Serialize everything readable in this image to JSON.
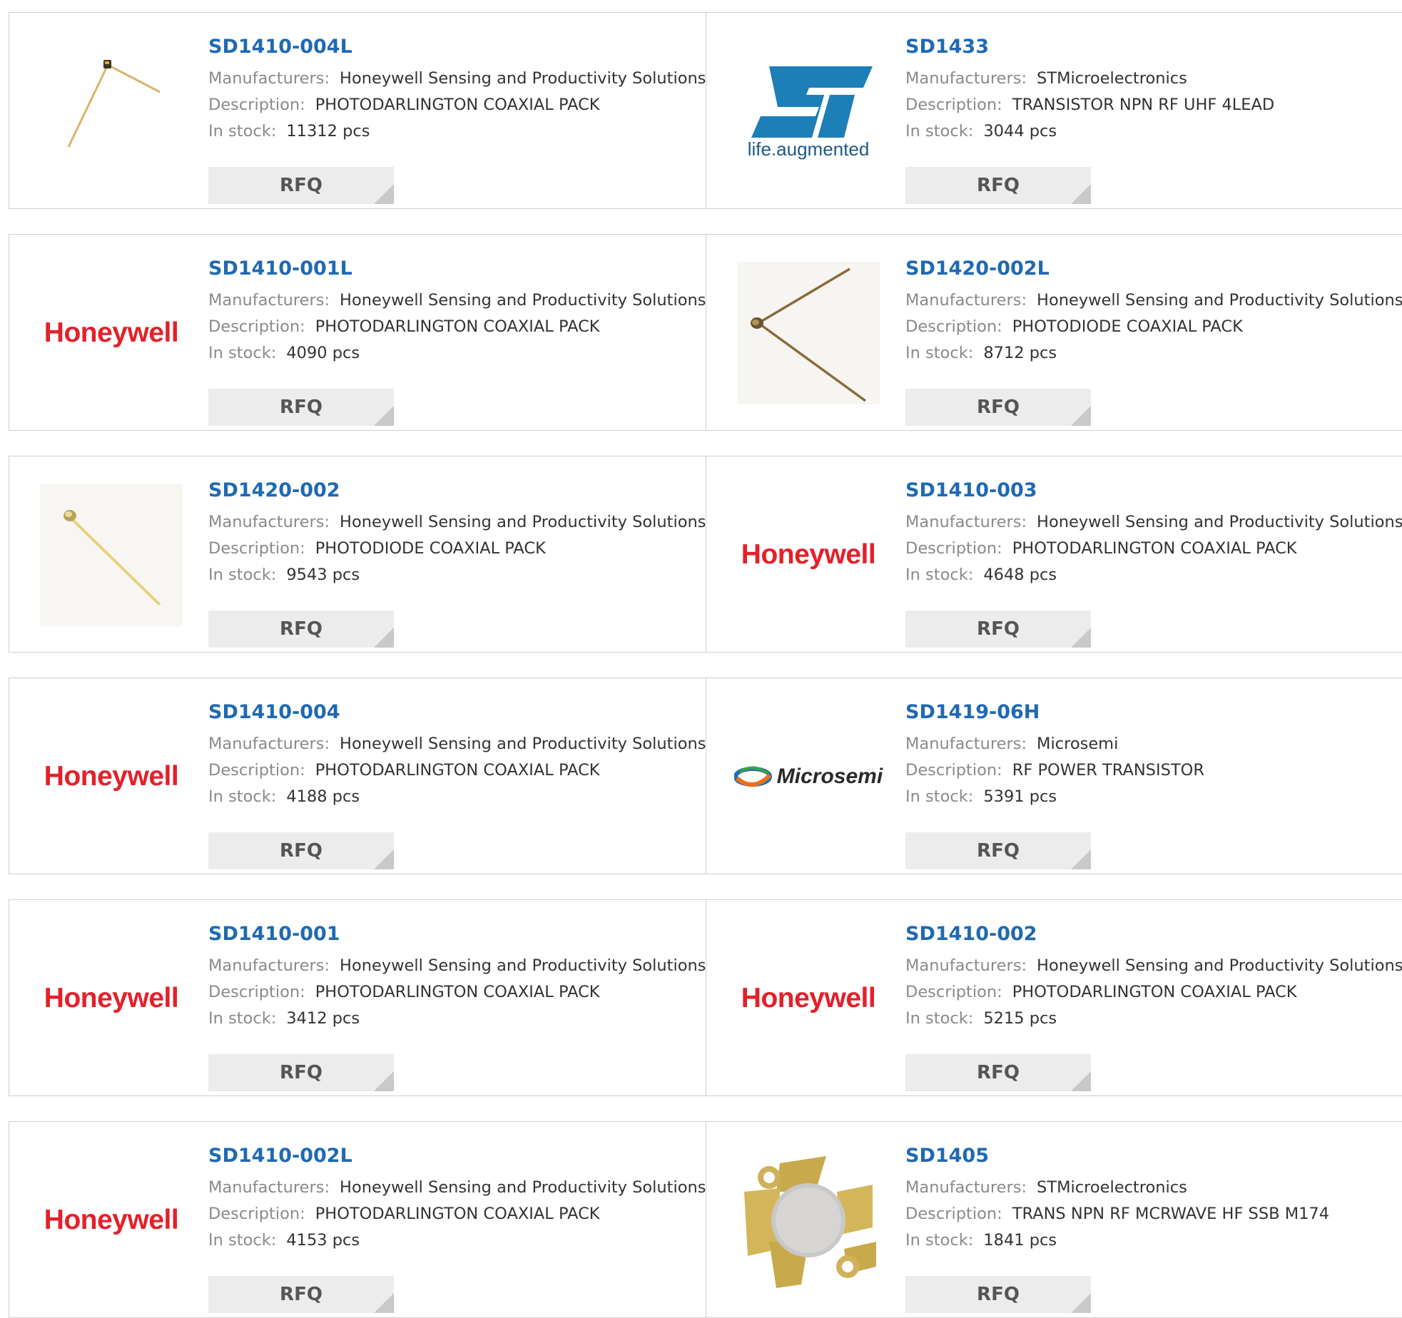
{
  "labels": {
    "manufacturers": "Manufacturers:",
    "description": "Description:",
    "in_stock": "In stock:",
    "rfq": "RFQ"
  },
  "products": [
    {
      "part": "SD1410-004L",
      "manufacturer": "Honeywell Sensing and Productivity Solutions",
      "description": "PHOTODARLINGTON COAXIAL PACK",
      "stock": "11312 pcs",
      "image": "component-wire-photo"
    },
    {
      "part": "SD1433",
      "manufacturer": "STMicroelectronics",
      "description": "TRANSISTOR NPN RF UHF 4LEAD",
      "stock": "3044 pcs",
      "image": "st-logo",
      "logo_tagline": "life.augmented"
    },
    {
      "part": "SD1410-001L",
      "manufacturer": "Honeywell Sensing and Productivity Solutions",
      "description": "PHOTODARLINGTON COAXIAL PACK",
      "stock": "4090 pcs",
      "image": "honeywell-logo",
      "logo_text": "Honeywell"
    },
    {
      "part": "SD1420-002L",
      "manufacturer": "Honeywell Sensing and Productivity Solutions",
      "description": "PHOTODIODE COAXIAL PACK",
      "stock": "8712 pcs",
      "image": "component-bent-wire-photo"
    },
    {
      "part": "SD1420-002",
      "manufacturer": "Honeywell Sensing and Productivity Solutions",
      "description": "PHOTODIODE COAXIAL PACK",
      "stock": "9543 pcs",
      "image": "component-straight-wire-photo"
    },
    {
      "part": "SD1410-003",
      "manufacturer": "Honeywell Sensing and Productivity Solutions",
      "description": "PHOTODARLINGTON COAXIAL PACK",
      "stock": "4648 pcs",
      "image": "honeywell-logo",
      "logo_text": "Honeywell"
    },
    {
      "part": "SD1410-004",
      "manufacturer": "Honeywell Sensing and Productivity Solutions",
      "description": "PHOTODARLINGTON COAXIAL PACK",
      "stock": "4188 pcs",
      "image": "honeywell-logo",
      "logo_text": "Honeywell"
    },
    {
      "part": "SD1419-06H",
      "manufacturer": "Microsemi",
      "description": "RF POWER TRANSISTOR",
      "stock": "5391 pcs",
      "image": "microsemi-logo",
      "logo_text": "Microsemi"
    },
    {
      "part": "SD1410-001",
      "manufacturer": "Honeywell Sensing and Productivity Solutions",
      "description": "PHOTODARLINGTON COAXIAL PACK",
      "stock": "3412 pcs",
      "image": "honeywell-logo",
      "logo_text": "Honeywell"
    },
    {
      "part": "SD1410-002",
      "manufacturer": "Honeywell Sensing and Productivity Solutions",
      "description": "PHOTODARLINGTON COAXIAL PACK",
      "stock": "5215 pcs",
      "image": "honeywell-logo",
      "logo_text": "Honeywell"
    },
    {
      "part": "SD1410-002L",
      "manufacturer": "Honeywell Sensing and Productivity Solutions",
      "description": "PHOTODARLINGTON COAXIAL PACK",
      "stock": "4153 pcs",
      "image": "honeywell-logo",
      "logo_text": "Honeywell"
    },
    {
      "part": "SD1405",
      "manufacturer": "STMicroelectronics",
      "description": "TRANS NPN RF MCRWAVE HF SSB M174",
      "stock": "1841 pcs",
      "image": "rf-transistor-package-photo"
    }
  ],
  "colors": {
    "part_link": "#1f69b3",
    "label_gray": "#8a8a8a",
    "value_dark": "#333333",
    "rfq_bg": "#ececec",
    "honeywell_red": "#e4202a",
    "st_blue": "#1d7fb8",
    "border": "#cfcfcf"
  }
}
